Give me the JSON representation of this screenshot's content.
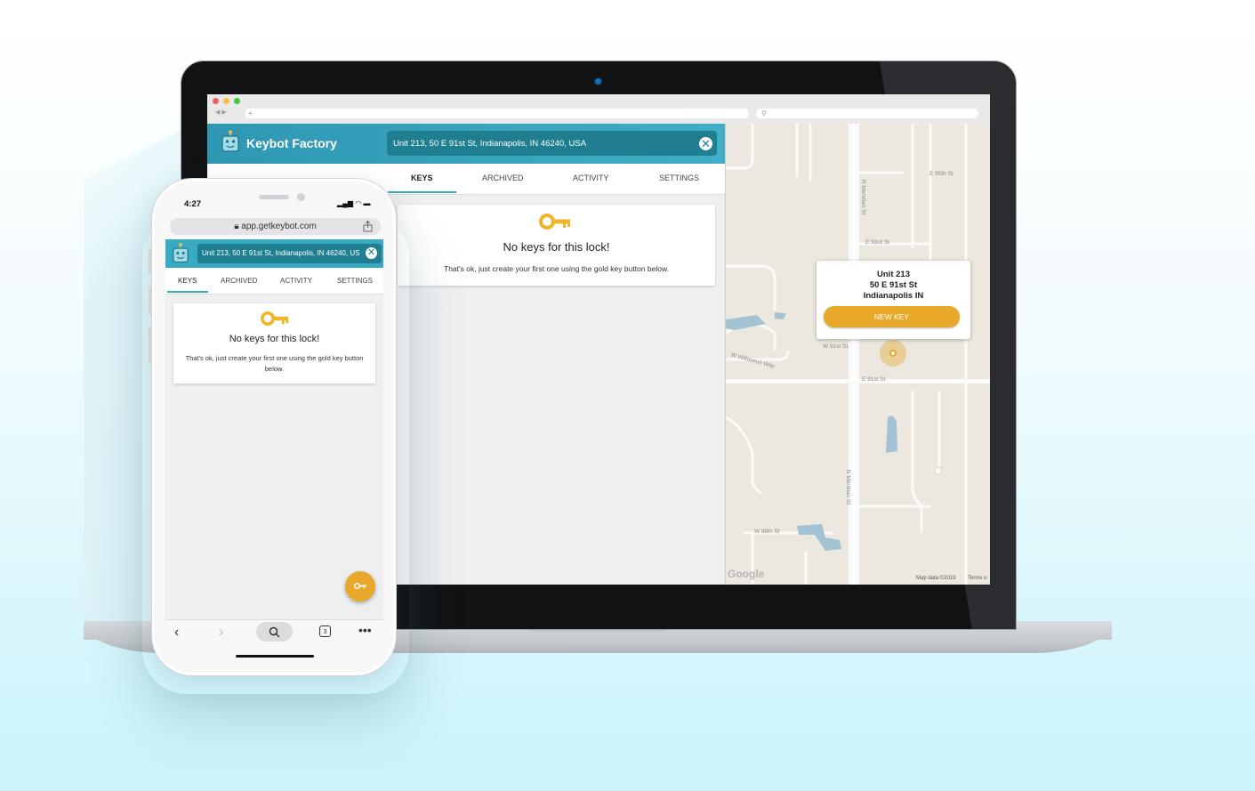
{
  "desktop": {
    "app": {
      "title": "Keybot Factory"
    },
    "address": "Unit 213, 50 E 91st St, Indianapolis, IN 46240, USA",
    "tabs": [
      {
        "label": "KEYS",
        "active": true
      },
      {
        "label": "ARCHIVED",
        "active": false
      },
      {
        "label": "ACTIVITY",
        "active": false
      },
      {
        "label": "SETTINGS",
        "active": false
      }
    ],
    "empty_state": {
      "title": "No keys for this lock!",
      "subtitle": "That's ok, just create your first one using the gold key button below."
    },
    "map": {
      "popup": {
        "line1": "Unit 213",
        "line2": "50 E 91st St",
        "line3": "Indianapolis IN",
        "button": "NEW KEY"
      },
      "street_labels": [
        "N Meridian St",
        "N Meridian St",
        "N Meridian St",
        "W 91st St",
        "E 91st St",
        "W Willowrun Way",
        "W 88th St",
        "E 95th St",
        "E 93rd St"
      ],
      "provider": "Google",
      "credit": "Map data ©2019",
      "terms": "Terms o"
    }
  },
  "mobile": {
    "time": "4:27",
    "url": "app.getkeybot.com",
    "address": "Unit 213, 50 E 91st St, Indianapolis, IN 46240, US",
    "tabs": [
      {
        "label": "KEYS",
        "active": true
      },
      {
        "label": "ARCHIVED",
        "active": false
      },
      {
        "label": "ACTIVITY",
        "active": false
      },
      {
        "label": "SETTINGS",
        "active": false
      }
    ],
    "empty_state": {
      "title": "No keys for this lock!",
      "subtitle": "That's ok, just create your first one using the gold key button below."
    },
    "tab_count": "3"
  },
  "colors": {
    "brand": "#3aa9c2",
    "brand_dark": "#1f7f90",
    "gold": "#e8a92a"
  }
}
